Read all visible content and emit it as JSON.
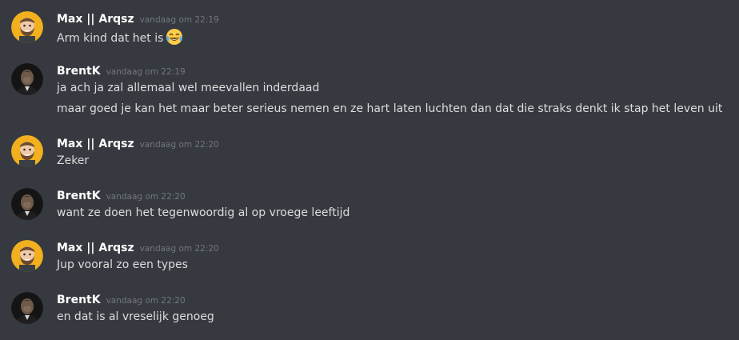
{
  "messages": [
    {
      "author": "Max || Arqsz",
      "avatar": "cartoon-bearded-man-avatar",
      "timestamp": "vandaag om 22:19",
      "lines": [
        {
          "text": "Arm kind dat het is",
          "emoji": "face-with-tears-of-joy"
        }
      ]
    },
    {
      "author": "BrentK",
      "avatar": "dark-photo-man-avatar",
      "timestamp": "vandaag om 22:19",
      "lines": [
        {
          "text": "ja ach ja zal allemaal wel meevallen inderdaad"
        },
        {
          "text": "maar goed je kan het maar beter serieus nemen en ze hart laten luchten dan dat die straks denkt ik stap het leven uit"
        }
      ]
    },
    {
      "author": "Max || Arqsz",
      "avatar": "cartoon-bearded-man-avatar",
      "timestamp": "vandaag om 22:20",
      "lines": [
        {
          "text": "Zeker"
        }
      ]
    },
    {
      "author": "BrentK",
      "avatar": "dark-photo-man-avatar",
      "timestamp": "vandaag om 22:20",
      "lines": [
        {
          "text": "want ze doen het tegenwoordig al op vroege leeftijd"
        }
      ]
    },
    {
      "author": "Max || Arqsz",
      "avatar": "cartoon-bearded-man-avatar",
      "timestamp": "vandaag om 22:20",
      "lines": [
        {
          "text": "Jup vooral zo een types"
        }
      ]
    },
    {
      "author": "BrentK",
      "avatar": "dark-photo-man-avatar",
      "timestamp": "vandaag om 22:20",
      "lines": [
        {
          "text": "en dat is al vreselijk genoeg"
        }
      ]
    }
  ],
  "colors": {
    "background": "#36393f",
    "author": "#ffffff",
    "timestamp": "#72767d",
    "text": "#dcddde"
  }
}
